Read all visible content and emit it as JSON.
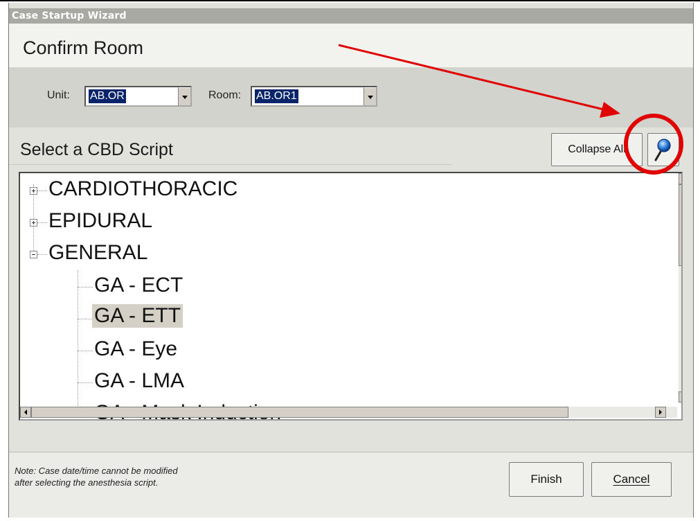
{
  "window": {
    "title": "Case Startup Wizard"
  },
  "header": {
    "title": "Confirm Room"
  },
  "room_selection": {
    "unit_label": "Unit:",
    "unit_value": "AB.OR",
    "room_label": "Room:",
    "room_value": "AB.OR1"
  },
  "script_section": {
    "title": "Select a CBD Script",
    "collapse_all_label": "Collapse All",
    "search_icon": "magnifier-icon"
  },
  "tree": {
    "nodes": [
      {
        "label": "CARDIOTHORACIC",
        "state": "collapsed"
      },
      {
        "label": "EPIDURAL",
        "state": "collapsed"
      },
      {
        "label": "GENERAL",
        "state": "expanded",
        "children": [
          "GA - ECT",
          "GA - ETT",
          "GA - Eye",
          "GA - LMA",
          "GA - Mask Induction"
        ]
      }
    ],
    "selected": "GA - ETT"
  },
  "footer": {
    "note_line1": "Note:  Case date/time cannot be modified",
    "note_line2": "after selecting the anesthesia script.",
    "finish_label": "Finish",
    "cancel_label": "Cancel"
  },
  "annotation": {
    "color": "#e00000"
  }
}
